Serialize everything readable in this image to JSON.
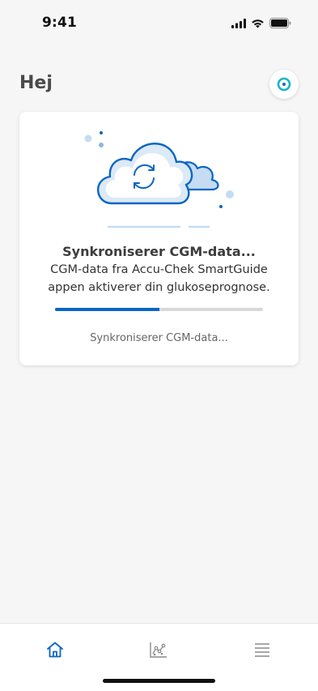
{
  "status_bar": {
    "time": "9:41",
    "icons": [
      "cellular-signal-icon",
      "wifi-icon",
      "battery-icon"
    ]
  },
  "header": {
    "title": "Hej",
    "profile_icon": "profile-ring-icon"
  },
  "sync_card": {
    "illustration": "cloud-sync-icon",
    "title": "Synkroniserer CGM-data...",
    "description": "CGM-data fra Accu-Chek SmartGuide appen aktiverer din glukoseprognose.",
    "progress": 0.5,
    "status_text": "Synkroniserer CGM-data..."
  },
  "tab_bar": {
    "tabs": [
      {
        "icon": "home-icon",
        "active": true
      },
      {
        "icon": "chart-icon",
        "active": false
      },
      {
        "icon": "menu-icon",
        "active": false
      }
    ]
  },
  "colors": {
    "accent": "#0a66c2",
    "teal": "#1bb3c7",
    "light_blue": "#c5dcf2",
    "background": "#f6f6f6"
  }
}
